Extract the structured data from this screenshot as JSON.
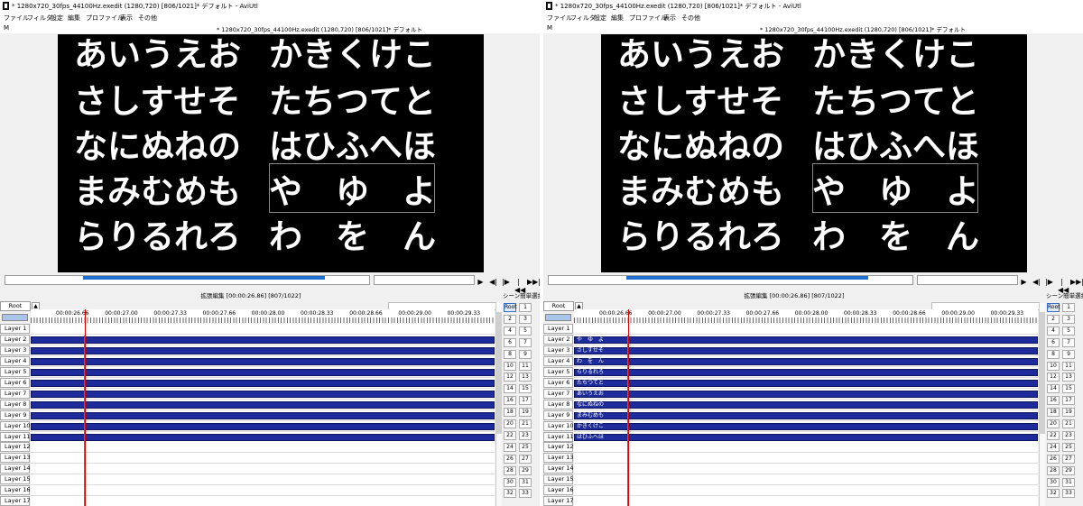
{
  "window": {
    "title": "* 1280x720_30fps_44100Hz.exedit (1280,720)  [806/1021]*  デフォルト - AviUtl",
    "sub_title": "* 1280x720_30fps_44100Hz.exedit (1280,720)  [806/1021]*  デフォルト",
    "sub_m": "M"
  },
  "menu": [
    "ファイル",
    "フィルタ",
    "設定",
    "編集",
    "プロファイル",
    "表示",
    "その他"
  ],
  "preview": {
    "rows": [
      [
        "あいうえお",
        "かきくけこ"
      ],
      [
        "さしすせそ",
        "たちつてと"
      ],
      [
        "なにぬねの",
        "はひふへほ"
      ],
      [
        "まみむめも",
        "や　ゆ　よ"
      ],
      [
        "らりるれろ",
        "わ　を　ん"
      ]
    ]
  },
  "player": {
    "play": "▶",
    "prev_frame": "◀|",
    "next_frame": "|▶",
    "to_start": "|◀◀",
    "to_end": "▶▶|"
  },
  "timeline": {
    "title": "拡張編集 [00:00:26.86] [807/1022]",
    "root_label": "Root",
    "zoom_label": "▲",
    "ruler": [
      "00:00:26.66",
      "00:00:27.00",
      "00:00:27.33",
      "00:00:27.66",
      "00:00:28.00",
      "00:00:28.33",
      "00:00:28.66",
      "00:00:29.00",
      "00:00:29.33"
    ],
    "layers": [
      "Layer 1",
      "Layer 2",
      "Layer 3",
      "Layer 4",
      "Layer 5",
      "Layer 6",
      "Layer 7",
      "Layer 8",
      "Layer 9",
      "Layer 10",
      "Layer 11",
      "Layer 12",
      "Layer 13",
      "Layer 14",
      "Layer 15",
      "Layer 16",
      "Layer 17"
    ],
    "objects_left": [
      "",
      "",
      "",
      "",
      "",
      "",
      "",
      "",
      "",
      ""
    ],
    "objects_right": [
      "や　ゆ　よ",
      "さしすせそ",
      "わ　を　ん",
      "らりるれろ",
      "たちつてと",
      "あいうえお",
      "なにぬねの",
      "まみむめも",
      "かきくけこ",
      "はひふへほ"
    ]
  },
  "scene": {
    "title": "シーン簡単選択",
    "root": "Root",
    "numbers": [
      "1",
      "2",
      "3",
      "4",
      "5",
      "6",
      "7",
      "8",
      "9",
      "10",
      "11",
      "12",
      "13",
      "14",
      "15",
      "16",
      "17",
      "18",
      "19",
      "20",
      "21",
      "22",
      "23",
      "24",
      "25",
      "26",
      "27",
      "28",
      "29",
      "30",
      "31",
      "32",
      "33"
    ]
  },
  "colors": {
    "object_fill": "#1d2c9a",
    "seek_fill": "#1e6fd0",
    "cursor": "#e00000",
    "preview_bg": "#000000"
  }
}
